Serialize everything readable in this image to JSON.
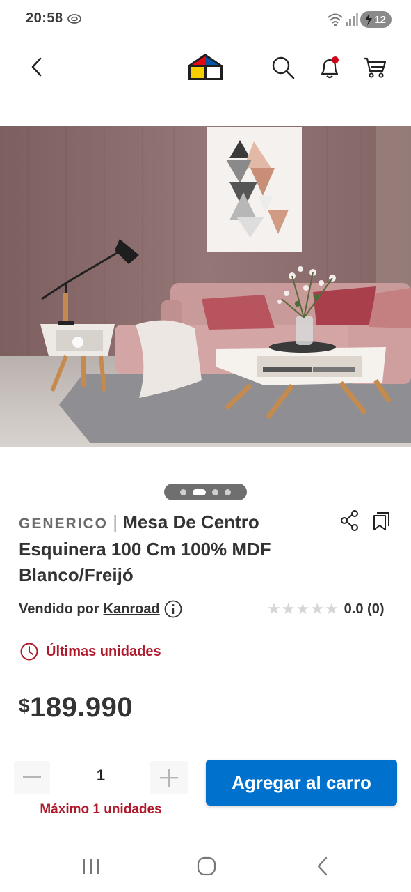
{
  "status_bar": {
    "time": "20:58",
    "battery": "12",
    "icons": [
      "sync-icon",
      "wifi-icon",
      "signal-icon",
      "battery-charging-icon"
    ]
  },
  "nav": {
    "icons": [
      "back-icon",
      "house-logo",
      "search-icon",
      "bell-icon",
      "cart-icon"
    ],
    "notification_dot_color": "#d0021b"
  },
  "carousel": {
    "total": 4,
    "active": 2
  },
  "product": {
    "brand": "GENERICO",
    "separator": "|",
    "title": "Mesa De Centro Esquinera 100 Cm 100% MDF Blanco/Freijó",
    "seller_label": "Vendido por",
    "seller_name": "Kanroad",
    "rating_value": "0.0 (0)",
    "stars": 5,
    "stock_message": "Últimas unidades",
    "currency": "$",
    "price": "189.990"
  },
  "purchase": {
    "quantity": "1",
    "max_message": "Máximo 1 unidades",
    "add_to_cart_label": "Agregar al carro"
  },
  "colors": {
    "accent_blue": "#0072ce",
    "alert_red": "#b0182b",
    "text": "#333333"
  }
}
